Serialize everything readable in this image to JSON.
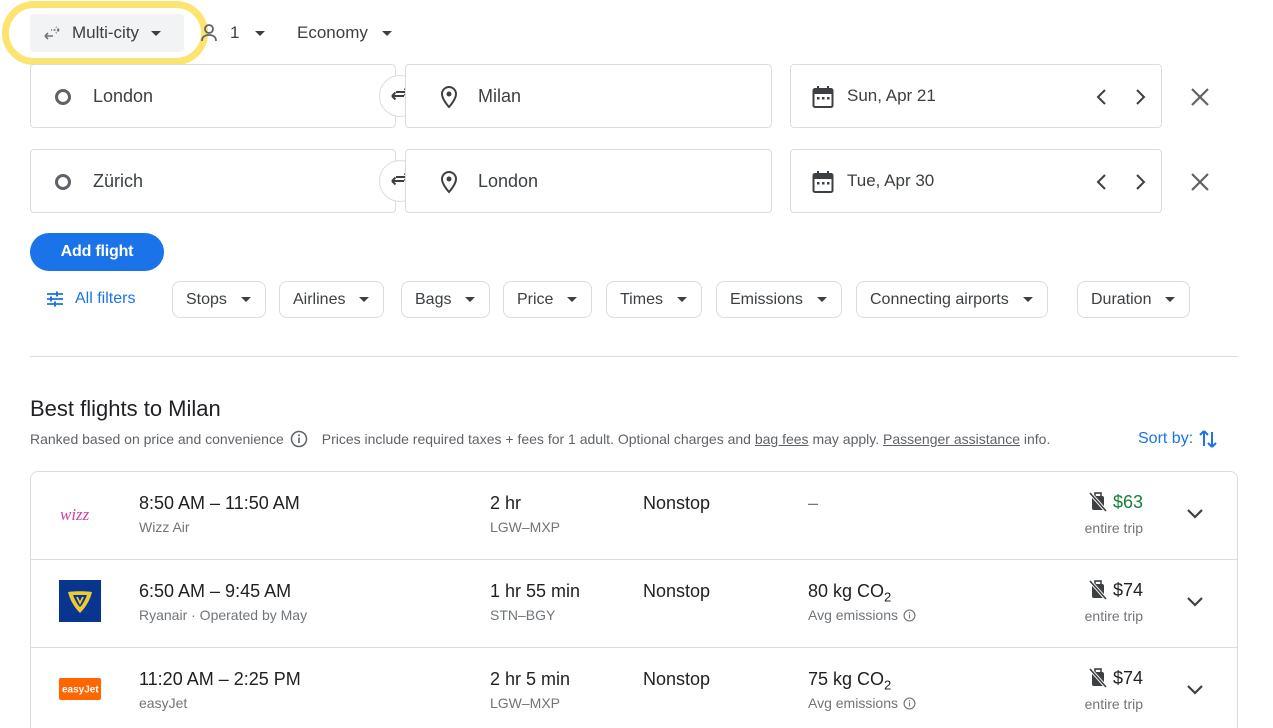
{
  "top_bar": {
    "trip_type": "Multi-city",
    "passengers": "1",
    "cabin": "Economy"
  },
  "legs": [
    {
      "origin": "London",
      "destination": "Milan",
      "date": "Sun, Apr 21"
    },
    {
      "origin": "Zürich",
      "destination": "London",
      "date": "Tue, Apr 30"
    }
  ],
  "add_flight_label": "Add flight",
  "filters": {
    "all_filters": "All filters",
    "chips": [
      "Stops",
      "Airlines",
      "Bags",
      "Price",
      "Times",
      "Emissions",
      "Connecting airports",
      "Duration"
    ]
  },
  "results": {
    "title": "Best flights to Milan",
    "ranked_text": "Ranked based on price and convenience",
    "prices_text": "Prices include required taxes + fees for 1 adult. Optional charges and",
    "bag_fees_link": "bag fees",
    "may_apply": "may apply.",
    "passenger_link": "Passenger assistance",
    "info_text": "info.",
    "sort_by": "Sort by:",
    "flights": [
      {
        "logo": "wizz-air-logo",
        "times": "8:50 AM – 11:50 AM",
        "airline": "Wizz Air",
        "duration": "2 hr",
        "route": "LGW–MXP",
        "stops": "Nonstop",
        "emissions": "–",
        "emissions_label": "",
        "price": "$63",
        "price_color": "#188038",
        "price_label": "entire trip"
      },
      {
        "logo": "ryanair-logo",
        "times": "6:50 AM – 9:45 AM",
        "airline": "Ryanair · Operated by May",
        "duration": "1 hr 55 min",
        "route": "STN–BGY",
        "stops": "Nonstop",
        "emissions": "80 kg CO",
        "emissions_sub": "2",
        "emissions_label": "Avg emissions",
        "price": "$74",
        "price_color": "#202124",
        "price_label": "entire trip"
      },
      {
        "logo": "easyjet-logo",
        "times": "11:20 AM – 2:25 PM",
        "airline": "easyJet",
        "duration": "2 hr 5 min",
        "route": "LGW–MXP",
        "stops": "Nonstop",
        "emissions": "75 kg CO",
        "emissions_sub": "2",
        "emissions_label": "Avg emissions",
        "price": "$74",
        "price_color": "#202124",
        "price_label": "entire trip"
      }
    ]
  },
  "colors": {
    "accent": "#1a73e8",
    "highlight": "#fce471",
    "price_green": "#188038",
    "border": "#dadce0"
  }
}
